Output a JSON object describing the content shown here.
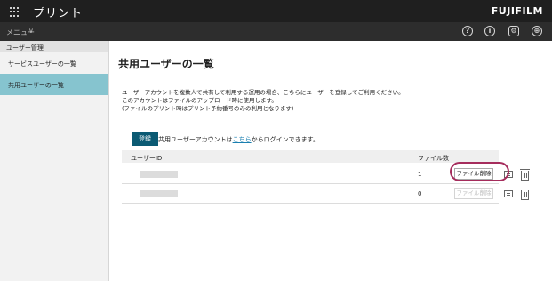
{
  "header": {
    "app_title": "プリント",
    "brand": "FUJIFILM",
    "menu_label": "メニュー",
    "menu_chevron": "∨",
    "help_icon": "?",
    "info_icon": "i",
    "settings_icon": "⚙",
    "user_icon": "⊕"
  },
  "sidebar": {
    "group_label": "ユーザー管理",
    "items": [
      {
        "label": "サービスユーザーの一覧"
      },
      {
        "label": "共用ユーザーの一覧"
      }
    ]
  },
  "main": {
    "title": "共用ユーザーの一覧",
    "description": [
      "ユーザーアカウントを複数人で共有して利用する運用の場合、こちらにユーザーを登録してご利用ください。",
      "このアカウントはファイルのアップロード時に使用します。",
      "(ファイルのプリント時はプリント予約番号のみの利用となります)"
    ],
    "register_button": "登録",
    "login_note_prefix": "共用ユーザーアカウントは",
    "login_note_link": "こちら",
    "login_note_suffix": "からログインできます。",
    "table": {
      "columns": [
        "ユーザーID",
        "ファイル数"
      ],
      "rows": [
        {
          "file_count": "1",
          "delete_label": "ファイル削除"
        },
        {
          "file_count": "0",
          "delete_label": "ファイル削除"
        }
      ]
    }
  },
  "colors": {
    "topbar": "#1f1f1f",
    "active_sidebar": "#86c4cf",
    "primary_button": "#0b5a73",
    "highlight_ring": "#a52c5c",
    "link": "#1a7fb0"
  }
}
